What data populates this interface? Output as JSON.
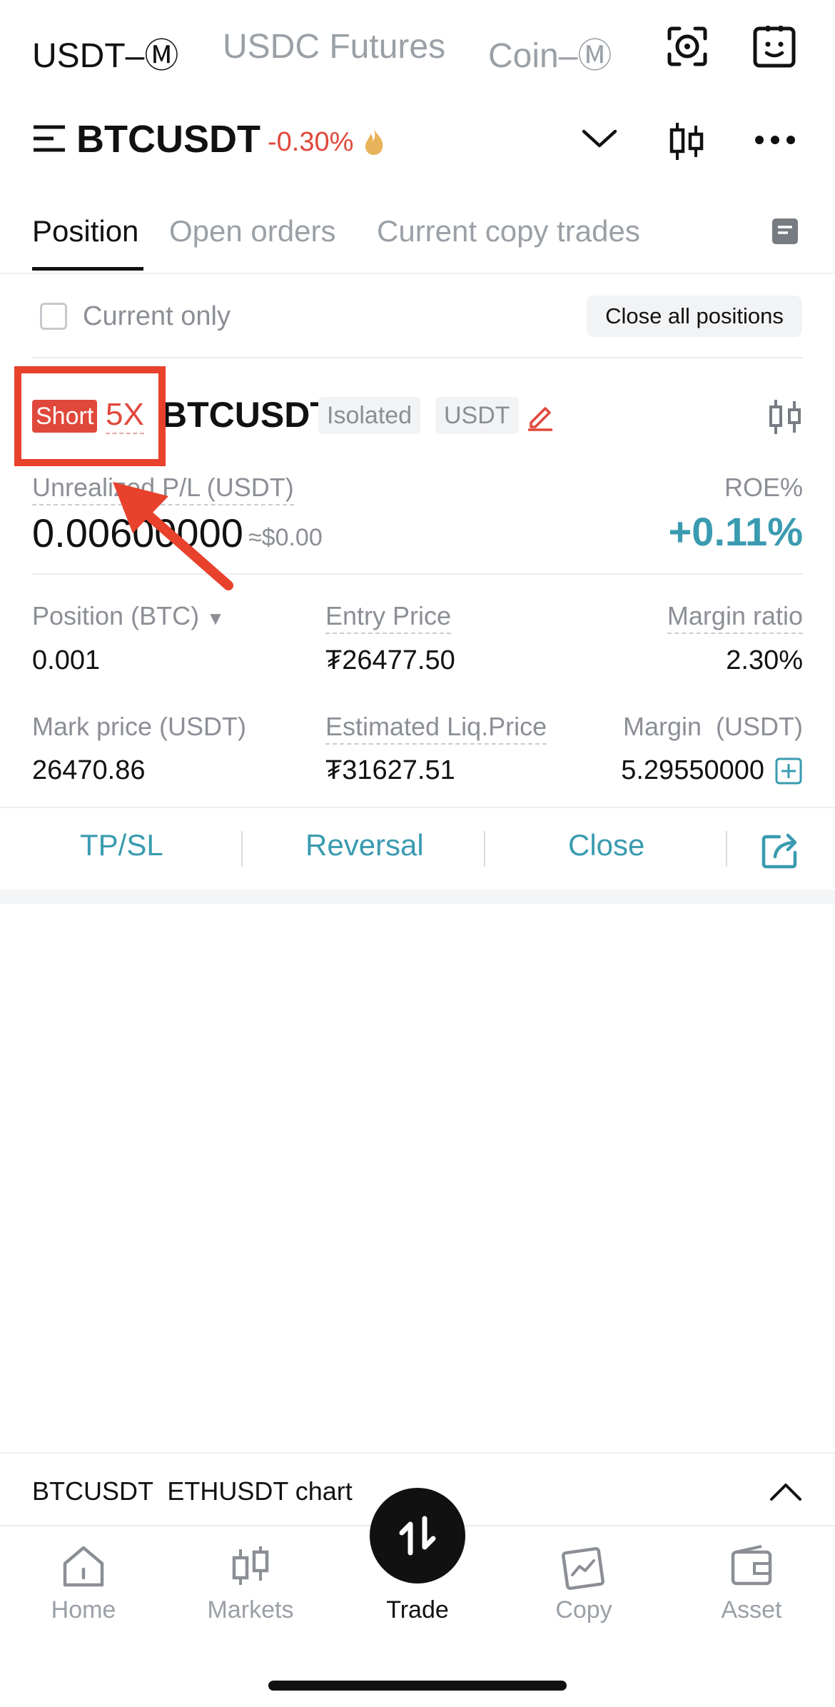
{
  "top_tabs": [
    "USDT–Ⓜ",
    "USDC Futures",
    "Coin–Ⓜ"
  ],
  "header": {
    "pair": "BTCUSDT",
    "change": "-0.30%"
  },
  "sub_tabs": [
    "Position",
    "Open orders",
    "Current copy trades"
  ],
  "filter": {
    "current_only_label": "Current only",
    "close_all_label": "Close all positions"
  },
  "position": {
    "side": "Short",
    "leverage": "5X",
    "symbol": "BTCUSDT",
    "margin_mode": "Isolated",
    "settle": "USDT",
    "unrealized_label": "Unrealized P/L (USDT)",
    "unrealized_value": "0.00600000",
    "unrealized_usd": "≈$0.00",
    "roe_label": "ROE%",
    "roe_value": "+0.11%",
    "position_label": "Position (BTC)",
    "position_value": "0.001",
    "entry_label": "Entry Price",
    "entry_value": "₮26477.50",
    "margin_ratio_label": "Margin ratio",
    "margin_ratio_value": "2.30%",
    "mark_label": "Mark price (USDT)",
    "mark_value": "26470.86",
    "liq_label": "Estimated Liq.Price",
    "liq_value": "₮31627.51",
    "margin_label": "Margin  (USDT)",
    "margin_value": "5.29550000"
  },
  "actions": [
    "TP/SL",
    "Reversal",
    "Close"
  ],
  "chart_bar": {
    "label": "BTCUSDT  ETHUSDT chart"
  },
  "bottom_nav": [
    "Home",
    "Markets",
    "Trade",
    "Copy",
    "Asset"
  ],
  "colors": {
    "accent": "#3a9bb0",
    "short": "#e0483b",
    "annotation": "#e8412c"
  }
}
